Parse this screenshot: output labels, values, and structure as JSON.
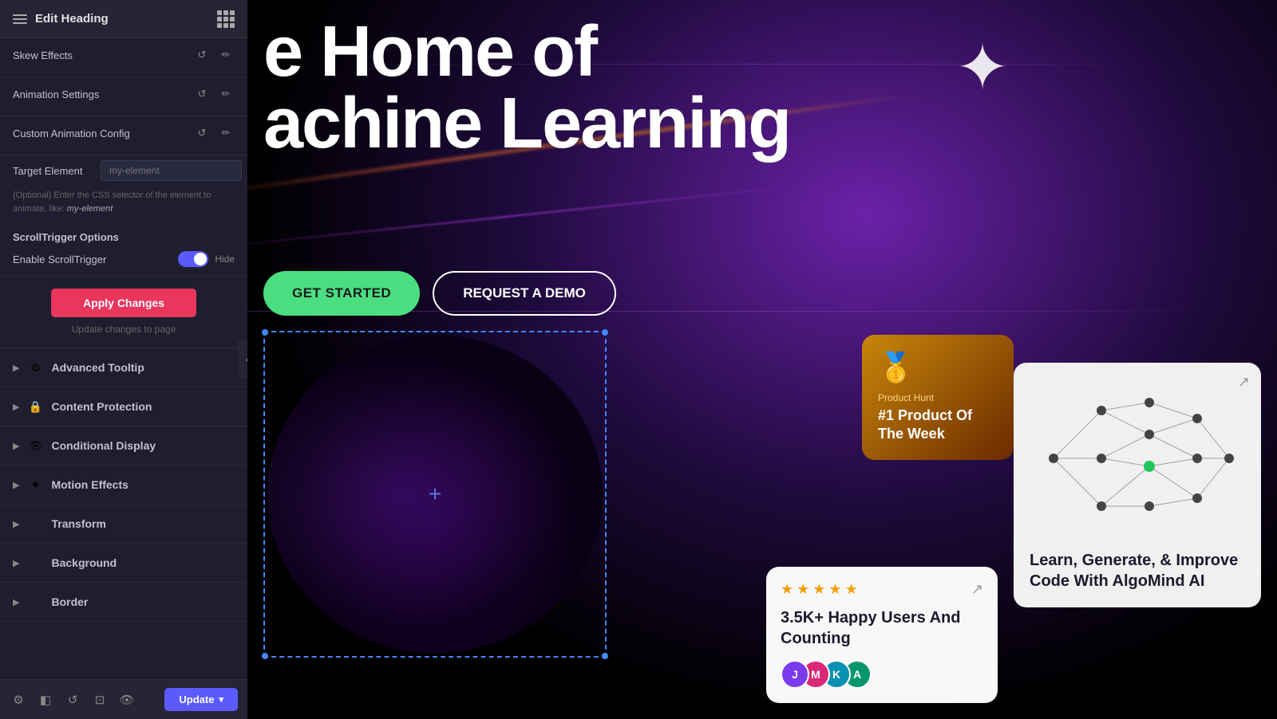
{
  "panel": {
    "title": "Edit Heading",
    "sections": {
      "skew_effects": {
        "label": "Skew Effects"
      },
      "animation_settings": {
        "label": "Animation Settings"
      },
      "custom_animation_config": {
        "label": "Custom Animation Config"
      },
      "target_element": {
        "label": "Target Element",
        "placeholder": "my-element"
      },
      "helper_text": "(Optional) Enter the CSS selector of the element to animate, like: ",
      "helper_em": "my-element",
      "scroll_trigger": {
        "section_title": "ScrollTrigger Options",
        "enable_label": "Enable ScrollTrigger",
        "toggle_state": "on",
        "toggle_side_label": "Hide"
      }
    },
    "apply_btn_label": "Apply Changes",
    "update_changes_text": "Update changes to page",
    "collapse_sections": [
      {
        "label": "Advanced Tooltip",
        "icon": "⚙"
      },
      {
        "label": "Content Protection",
        "icon": "🔒"
      },
      {
        "label": "Conditional Display",
        "icon": "👁"
      },
      {
        "label": "Motion Effects",
        "icon": "✦"
      },
      {
        "label": "Transform",
        "icon": ""
      },
      {
        "label": "Background",
        "icon": ""
      },
      {
        "label": "Border",
        "icon": ""
      }
    ],
    "toolbar": {
      "update_label": "Update"
    }
  },
  "canvas": {
    "hero_line1": "e Home of",
    "hero_line2": "achine Learning",
    "btn_get_started": "GET STARTED",
    "btn_request_demo": "REQUEST A DEMO",
    "plus_icon": "+",
    "product_hunt": {
      "label": "Product Hunt",
      "title": "#1 Product Of The Week"
    },
    "reviews": {
      "star_count": 5,
      "title": "3.5K+ Happy Users And Counting"
    },
    "ai_card": {
      "text": "Learn, Generate, & Improve Code With AlgoMind AI"
    }
  }
}
